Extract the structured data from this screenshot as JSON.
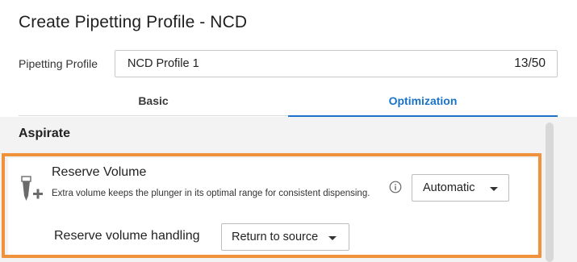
{
  "dialog": {
    "title": "Create Pipetting Profile - NCD"
  },
  "profile": {
    "label": "Pipetting Profile",
    "value": "NCD Profile 1",
    "counter": "13/50"
  },
  "tabs": [
    {
      "label": "Basic",
      "active": false
    },
    {
      "label": "Optimization",
      "active": true
    }
  ],
  "section": {
    "title": "Aspirate"
  },
  "reserve_volume": {
    "icon": "pipette-plus-icon",
    "title": "Reserve Volume",
    "description": "Extra volume keeps the plunger in its optimal range for consistent dispensing.",
    "info_icon": "info-icon",
    "mode": "Automatic",
    "handling_label": "Reserve volume handling",
    "handling_value": "Return to source"
  },
  "colors": {
    "accent": "#1a73c7",
    "highlight": "#f0913b",
    "panel_bg": "#f3f3f3"
  }
}
